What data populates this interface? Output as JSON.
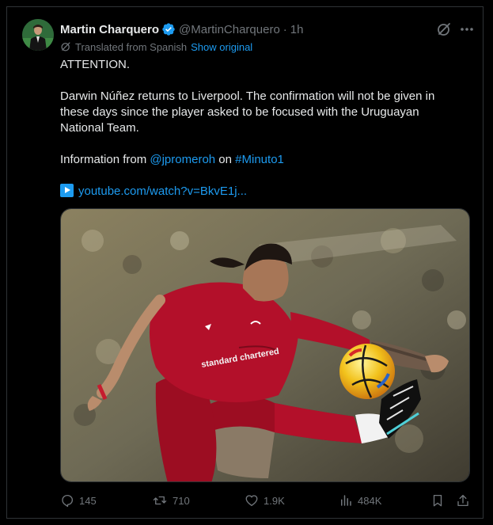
{
  "tweet": {
    "author_name": "Martin Charquero",
    "handle": "@MartinCharquero",
    "separator": "·",
    "time": "1h",
    "translated_label": "Translated from Spanish",
    "show_original": "Show original",
    "lines": {
      "p1": "ATTENTION.",
      "p2a": "Darwin Núñez returns to Liverpool. The confirmation will not be given in",
      "p2b": "these days since the player asked to be focused with the Uruguayan",
      "p2c": "National Team.",
      "p3_prefix": "Information from ",
      "p3_mention": "@jpromeroh",
      "p3_mid": " on ",
      "p3_hashtag": "#Minuto1",
      "p4_link": "youtube.com/watch?v=BkvE1j..."
    },
    "media_logo_text": "standard chartered"
  },
  "actions": {
    "replies": "145",
    "retweets": "710",
    "likes": "1.9K",
    "views": "484K"
  },
  "colors": {
    "background": "#000000",
    "text": "#e7e9ea",
    "secondary": "#71767b",
    "accent": "#1d9bf0",
    "border": "#2f3336",
    "jersey": "#b3102a"
  },
  "icons": {
    "verified": "verified-badge-icon",
    "grok": "grok-icon",
    "more": "more-icon",
    "translate": "translate-icon",
    "reply": "reply-icon",
    "retweet": "retweet-icon",
    "like": "heart-icon",
    "views": "views-icon",
    "bookmark": "bookmark-icon",
    "share": "share-icon",
    "video": "video-play-icon"
  }
}
